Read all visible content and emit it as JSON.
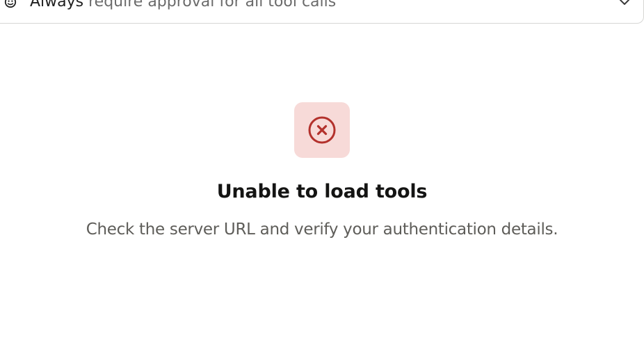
{
  "approval": {
    "mode_strong": "Always",
    "mode_rest": " require approval for all tool calls",
    "icon": "approval-mode-icon",
    "chevron": "chevron-down-icon"
  },
  "error": {
    "icon": "error-circle-x-icon",
    "title": "Unable to load tools",
    "message": "Check the server URL and verify your authentication details.",
    "badge_color": "#f7dad8",
    "icon_color": "#b3312c"
  }
}
